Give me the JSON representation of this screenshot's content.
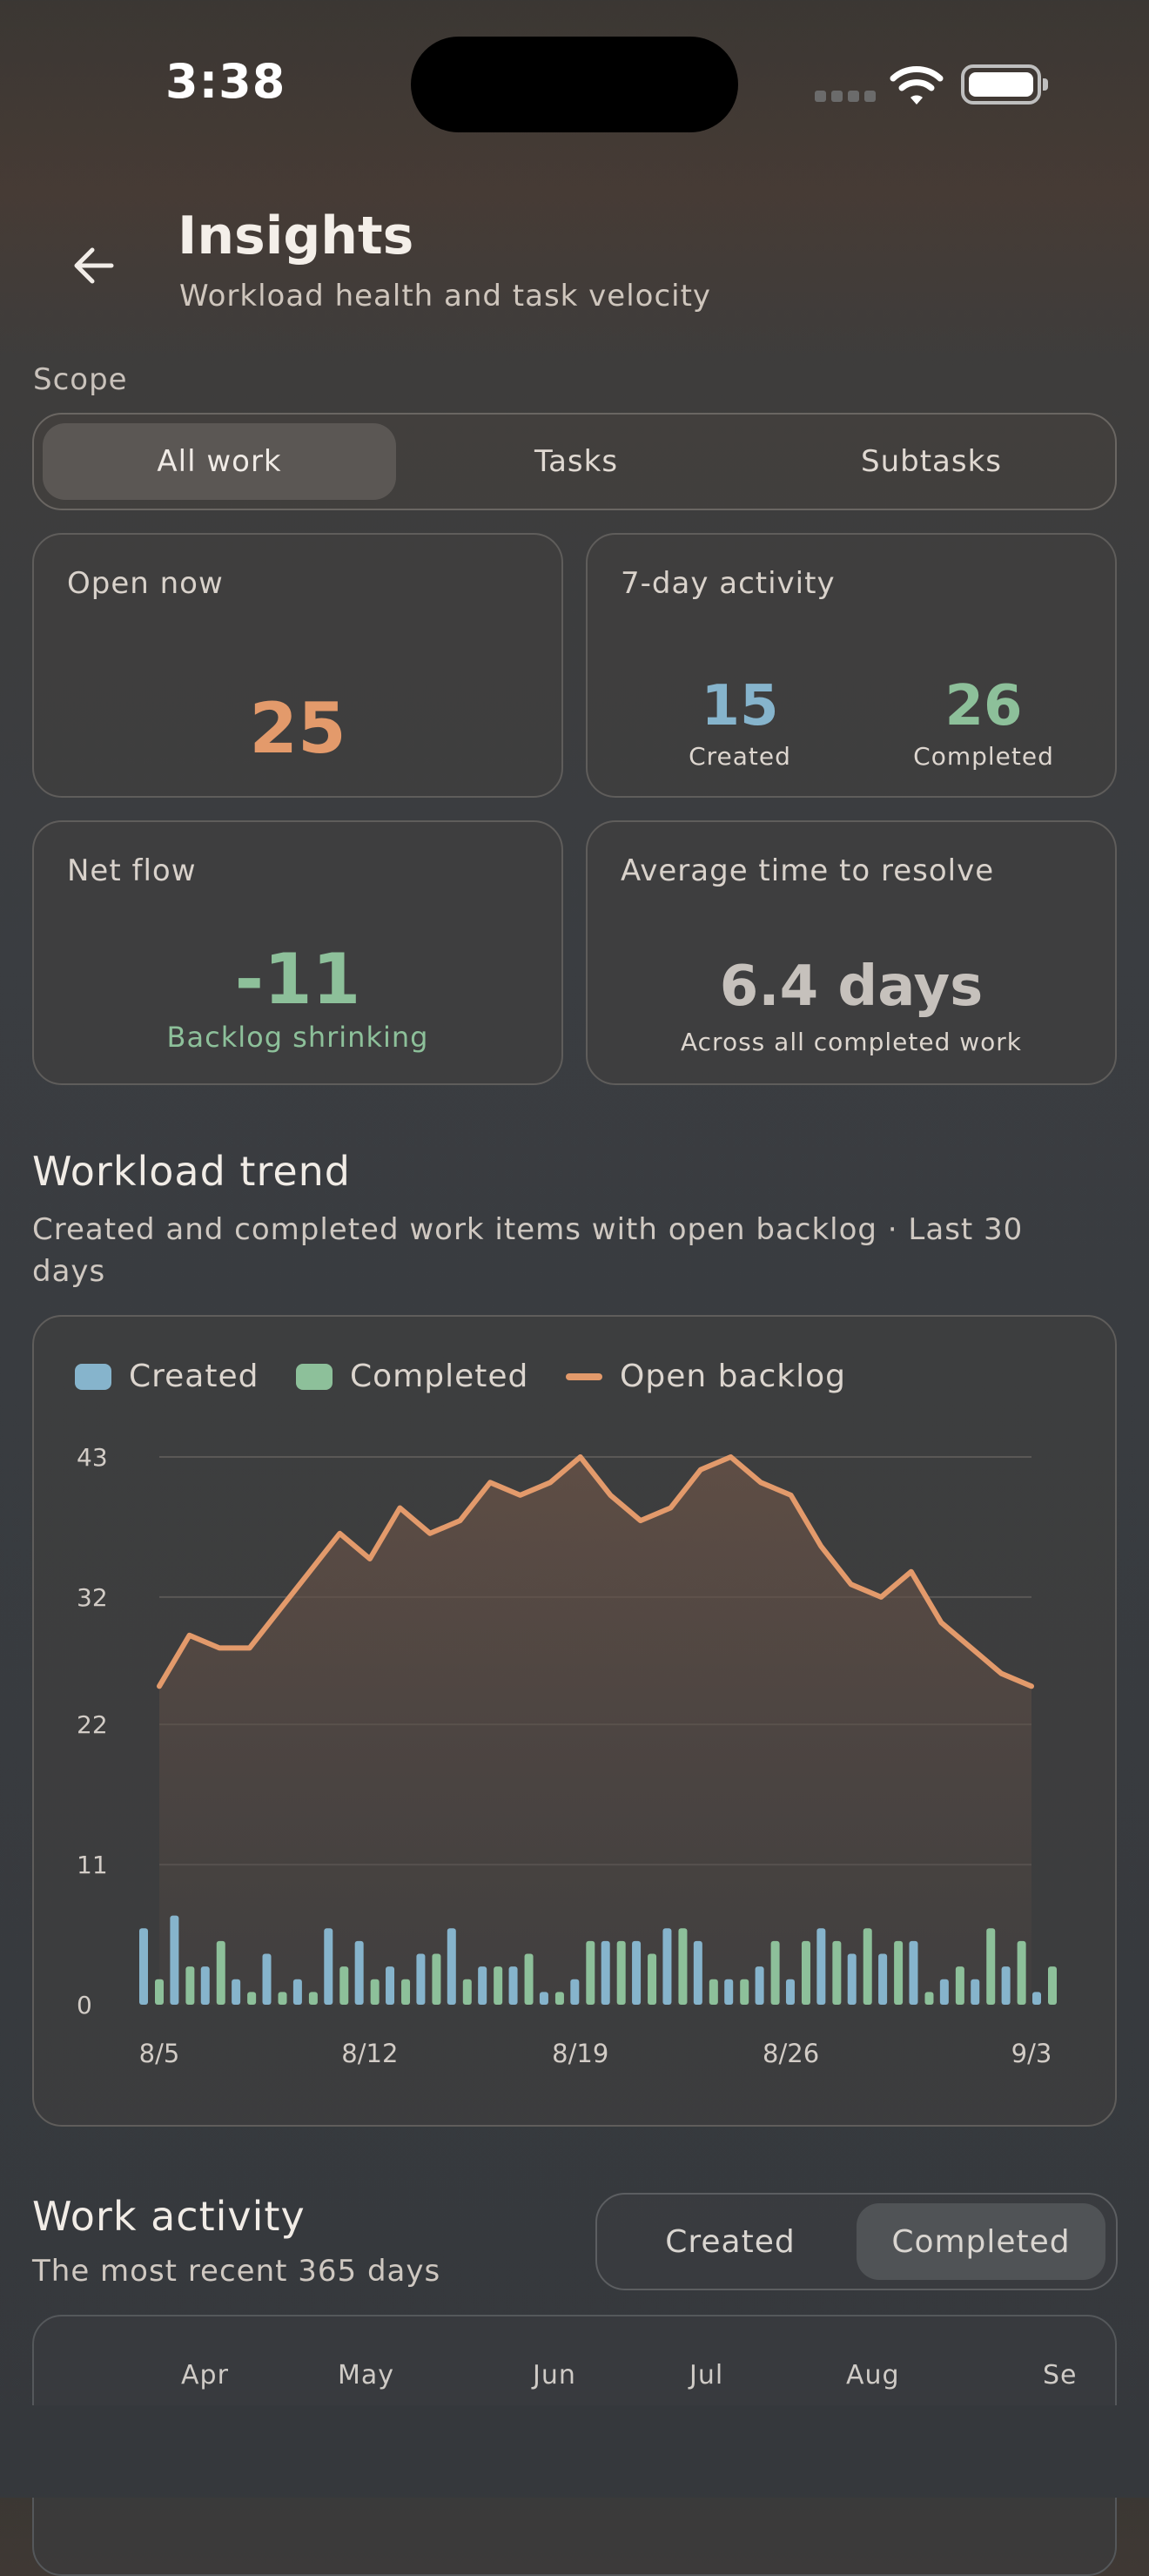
{
  "status_bar": {
    "time": "3:38"
  },
  "header": {
    "title": "Insights",
    "subtitle": "Workload health and task velocity"
  },
  "scope": {
    "label": "Scope",
    "options": [
      "All work",
      "Tasks",
      "Subtasks"
    ],
    "selected": "All work"
  },
  "stats": {
    "open_now": {
      "label": "Open now",
      "value": "25"
    },
    "activity": {
      "label": "7-day activity",
      "created_value": "15",
      "created_label": "Created",
      "completed_value": "26",
      "completed_label": "Completed"
    },
    "net_flow": {
      "label": "Net flow",
      "value": "-11",
      "note": "Backlog shrinking"
    },
    "resolve": {
      "label": "Average time to resolve",
      "value": "6.4 days",
      "note": "Across all completed work"
    }
  },
  "workload": {
    "title": "Workload trend",
    "subtitle_line1": "Created and completed work items with open backlog · Last 30",
    "subtitle_line2": "days",
    "legend": {
      "created": "Created",
      "completed": "Completed",
      "backlog": "Open backlog"
    }
  },
  "colors": {
    "created": "#86b4cc",
    "completed": "#8dc09a",
    "backlog": "#e39a6b",
    "accent_open": "#e39a6b"
  },
  "chart_data": {
    "type": "line",
    "y_ticks": [
      "43",
      "32",
      "22",
      "11",
      "0"
    ],
    "x_ticks": [
      "8/5",
      "8/12",
      "8/19",
      "8/26",
      "9/3"
    ],
    "ylim": [
      0,
      43
    ],
    "x": [
      "8/5",
      "8/6",
      "8/7",
      "8/8",
      "8/9",
      "8/10",
      "8/11",
      "8/12",
      "8/13",
      "8/14",
      "8/15",
      "8/16",
      "8/17",
      "8/18",
      "8/19",
      "8/20",
      "8/21",
      "8/22",
      "8/23",
      "8/24",
      "8/25",
      "8/26",
      "8/27",
      "8/28",
      "8/29",
      "8/30",
      "8/31",
      "9/1",
      "9/2",
      "9/3"
    ],
    "series": [
      {
        "name": "Open backlog",
        "kind": "line",
        "values": [
          25,
          29,
          28,
          28,
          31,
          34,
          37,
          35,
          39,
          37,
          38,
          41,
          40,
          41,
          43,
          40,
          38,
          39,
          42,
          43,
          41,
          40,
          36,
          33,
          32,
          34,
          30,
          28,
          26,
          25
        ]
      },
      {
        "name": "Created",
        "kind": "bar",
        "values": [
          6,
          7,
          3,
          2,
          4,
          2,
          6,
          5,
          3,
          4,
          6,
          3,
          3,
          1,
          2,
          5,
          5,
          6,
          5,
          2,
          3,
          2,
          6,
          4,
          4,
          5,
          2,
          2,
          3,
          1
        ]
      },
      {
        "name": "Completed",
        "kind": "bar",
        "values": [
          2,
          3,
          5,
          1,
          1,
          1,
          3,
          2,
          2,
          4,
          2,
          3,
          4,
          1,
          5,
          5,
          4,
          6,
          2,
          2,
          5,
          5,
          5,
          6,
          5,
          1,
          3,
          6,
          5,
          3
        ]
      }
    ]
  },
  "activity": {
    "title": "Work activity",
    "subtitle": "The most recent 365 days",
    "toggle": [
      "Created",
      "Completed"
    ],
    "selected": "Completed",
    "months": [
      "Apr",
      "May",
      "Jun",
      "Jul",
      "Aug",
      "Se"
    ]
  }
}
